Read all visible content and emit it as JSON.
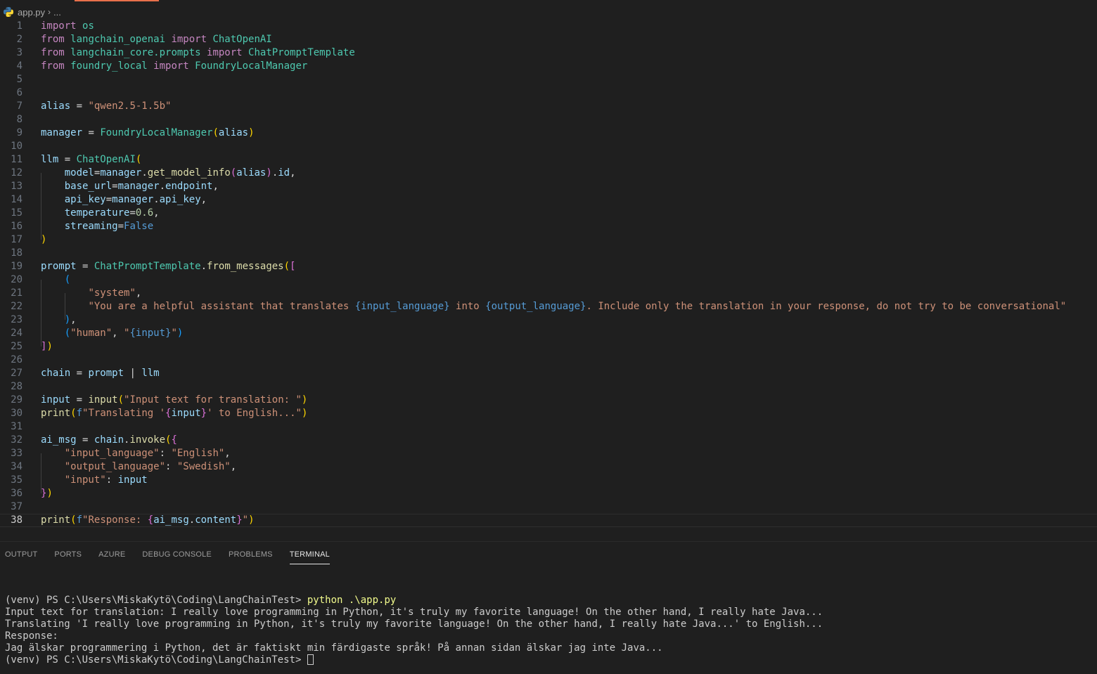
{
  "breadcrumb": {
    "file": "app.py",
    "rest": "..."
  },
  "colors": {
    "accent": "#e8704b",
    "background": "#1f1f1f",
    "keyword": "#c586c0",
    "string": "#ce9178",
    "class": "#4ec9b0",
    "variable": "#9cdcfe",
    "function": "#dcdcaa"
  },
  "editor": {
    "current_line": 38,
    "lines": [
      [
        {
          "t": "import ",
          "c": "kw"
        },
        {
          "t": "os",
          "c": "mod"
        }
      ],
      [
        {
          "t": "from ",
          "c": "kw"
        },
        {
          "t": "langchain_openai",
          "c": "mod"
        },
        {
          "t": " import ",
          "c": "kw"
        },
        {
          "t": "ChatOpenAI",
          "c": "cls"
        }
      ],
      [
        {
          "t": "from ",
          "c": "kw"
        },
        {
          "t": "langchain_core.prompts",
          "c": "mod"
        },
        {
          "t": " import ",
          "c": "kw"
        },
        {
          "t": "ChatPromptTemplate",
          "c": "cls"
        }
      ],
      [
        {
          "t": "from ",
          "c": "kw"
        },
        {
          "t": "foundry_local",
          "c": "mod"
        },
        {
          "t": " import ",
          "c": "kw"
        },
        {
          "t": "FoundryLocalManager",
          "c": "cls"
        }
      ],
      [],
      [],
      [
        {
          "t": "alias",
          "c": "var"
        },
        {
          "t": " = ",
          "c": "op"
        },
        {
          "t": "\"qwen2.5-1.5b\"",
          "c": "str"
        }
      ],
      [],
      [
        {
          "t": "manager",
          "c": "var"
        },
        {
          "t": " = ",
          "c": "op"
        },
        {
          "t": "FoundryLocalManager",
          "c": "cls"
        },
        {
          "t": "(",
          "c": "p1"
        },
        {
          "t": "alias",
          "c": "var"
        },
        {
          "t": ")",
          "c": "p1"
        }
      ],
      [],
      [
        {
          "t": "llm",
          "c": "var"
        },
        {
          "t": " = ",
          "c": "op"
        },
        {
          "t": "ChatOpenAI",
          "c": "cls"
        },
        {
          "t": "(",
          "c": "p1"
        }
      ],
      [
        {
          "t": "    "
        },
        {
          "t": "model",
          "c": "var"
        },
        {
          "t": "=",
          "c": "op"
        },
        {
          "t": "manager",
          "c": "var"
        },
        {
          "t": ".",
          "c": "op"
        },
        {
          "t": "get_model_info",
          "c": "fn"
        },
        {
          "t": "(",
          "c": "p2"
        },
        {
          "t": "alias",
          "c": "var"
        },
        {
          "t": ")",
          "c": "p2"
        },
        {
          "t": ".",
          "c": "op"
        },
        {
          "t": "id",
          "c": "var"
        },
        {
          "t": ",",
          "c": "op"
        }
      ],
      [
        {
          "t": "    "
        },
        {
          "t": "base_url",
          "c": "var"
        },
        {
          "t": "=",
          "c": "op"
        },
        {
          "t": "manager",
          "c": "var"
        },
        {
          "t": ".",
          "c": "op"
        },
        {
          "t": "endpoint",
          "c": "var"
        },
        {
          "t": ",",
          "c": "op"
        }
      ],
      [
        {
          "t": "    "
        },
        {
          "t": "api_key",
          "c": "var"
        },
        {
          "t": "=",
          "c": "op"
        },
        {
          "t": "manager",
          "c": "var"
        },
        {
          "t": ".",
          "c": "op"
        },
        {
          "t": "api_key",
          "c": "var"
        },
        {
          "t": ",",
          "c": "op"
        }
      ],
      [
        {
          "t": "    "
        },
        {
          "t": "temperature",
          "c": "var"
        },
        {
          "t": "=",
          "c": "op"
        },
        {
          "t": "0.6",
          "c": "num"
        },
        {
          "t": ",",
          "c": "op"
        }
      ],
      [
        {
          "t": "    "
        },
        {
          "t": "streaming",
          "c": "var"
        },
        {
          "t": "=",
          "c": "op"
        },
        {
          "t": "False",
          "c": "bool"
        }
      ],
      [
        {
          "t": ")",
          "c": "p1"
        }
      ],
      [],
      [
        {
          "t": "prompt",
          "c": "var"
        },
        {
          "t": " = ",
          "c": "op"
        },
        {
          "t": "ChatPromptTemplate",
          "c": "cls"
        },
        {
          "t": ".",
          "c": "op"
        },
        {
          "t": "from_messages",
          "c": "fn"
        },
        {
          "t": "(",
          "c": "p1"
        },
        {
          "t": "[",
          "c": "p2"
        }
      ],
      [
        {
          "t": "    "
        },
        {
          "t": "(",
          "c": "p3"
        }
      ],
      [
        {
          "t": "        "
        },
        {
          "t": "\"system\"",
          "c": "str"
        },
        {
          "t": ",",
          "c": "op"
        }
      ],
      [
        {
          "t": "        "
        },
        {
          "t": "\"You are a helpful assistant that translates ",
          "c": "str"
        },
        {
          "t": "{input_language}",
          "c": "interp"
        },
        {
          "t": " into ",
          "c": "str"
        },
        {
          "t": "{output_language}",
          "c": "interp"
        },
        {
          "t": ". Include only the translation in your response, do not try to be conversational\"",
          "c": "str"
        }
      ],
      [
        {
          "t": "    "
        },
        {
          "t": ")",
          "c": "p3"
        },
        {
          "t": ",",
          "c": "op"
        }
      ],
      [
        {
          "t": "    "
        },
        {
          "t": "(",
          "c": "p3"
        },
        {
          "t": "\"human\"",
          "c": "str"
        },
        {
          "t": ", ",
          "c": "op"
        },
        {
          "t": "\"",
          "c": "str"
        },
        {
          "t": "{input}",
          "c": "interp"
        },
        {
          "t": "\"",
          "c": "str"
        },
        {
          "t": ")",
          "c": "p3"
        }
      ],
      [
        {
          "t": "]",
          "c": "p2"
        },
        {
          "t": ")",
          "c": "p1"
        }
      ],
      [],
      [
        {
          "t": "chain",
          "c": "var"
        },
        {
          "t": " = ",
          "c": "op"
        },
        {
          "t": "prompt",
          "c": "var"
        },
        {
          "t": " | ",
          "c": "op"
        },
        {
          "t": "llm",
          "c": "var"
        }
      ],
      [],
      [
        {
          "t": "input",
          "c": "var"
        },
        {
          "t": " = ",
          "c": "op"
        },
        {
          "t": "input",
          "c": "fn"
        },
        {
          "t": "(",
          "c": "p1"
        },
        {
          "t": "\"Input text for translation: \"",
          "c": "str"
        },
        {
          "t": ")",
          "c": "p1"
        }
      ],
      [
        {
          "t": "print",
          "c": "fn"
        },
        {
          "t": "(",
          "c": "p1"
        },
        {
          "t": "f",
          "c": "fmt"
        },
        {
          "t": "\"Translating '",
          "c": "str"
        },
        {
          "t": "{",
          "c": "p2"
        },
        {
          "t": "input",
          "c": "var"
        },
        {
          "t": "}",
          "c": "p2"
        },
        {
          "t": "' to English...\"",
          "c": "str"
        },
        {
          "t": ")",
          "c": "p1"
        }
      ],
      [],
      [
        {
          "t": "ai_msg",
          "c": "var"
        },
        {
          "t": " = ",
          "c": "op"
        },
        {
          "t": "chain",
          "c": "var"
        },
        {
          "t": ".",
          "c": "op"
        },
        {
          "t": "invoke",
          "c": "fn"
        },
        {
          "t": "(",
          "c": "p1"
        },
        {
          "t": "{",
          "c": "p2"
        }
      ],
      [
        {
          "t": "    "
        },
        {
          "t": "\"input_language\"",
          "c": "str"
        },
        {
          "t": ": ",
          "c": "op"
        },
        {
          "t": "\"English\"",
          "c": "str"
        },
        {
          "t": ",",
          "c": "op"
        }
      ],
      [
        {
          "t": "    "
        },
        {
          "t": "\"output_language\"",
          "c": "str"
        },
        {
          "t": ": ",
          "c": "op"
        },
        {
          "t": "\"Swedish\"",
          "c": "str"
        },
        {
          "t": ",",
          "c": "op"
        }
      ],
      [
        {
          "t": "    "
        },
        {
          "t": "\"input\"",
          "c": "str"
        },
        {
          "t": ": ",
          "c": "op"
        },
        {
          "t": "input",
          "c": "var"
        }
      ],
      [
        {
          "t": "}",
          "c": "p2"
        },
        {
          "t": ")",
          "c": "p1"
        }
      ],
      [],
      [
        {
          "t": "print",
          "c": "fn"
        },
        {
          "t": "(",
          "c": "p1"
        },
        {
          "t": "f",
          "c": "fmt"
        },
        {
          "t": "\"Response: ",
          "c": "str"
        },
        {
          "t": "{",
          "c": "p2"
        },
        {
          "t": "ai_msg",
          "c": "var"
        },
        {
          "t": ".",
          "c": "op"
        },
        {
          "t": "content",
          "c": "var"
        },
        {
          "t": "}",
          "c": "p2"
        },
        {
          "t": "\"",
          "c": "str"
        },
        {
          "t": ")",
          "c": "p1"
        }
      ]
    ]
  },
  "panel": {
    "tabs": [
      "OUTPUT",
      "PORTS",
      "AZURE",
      "DEBUG CONSOLE",
      "PROBLEMS",
      "TERMINAL"
    ],
    "active_tab": "TERMINAL"
  },
  "terminal": {
    "prompt": "(venv) PS C:\\Users\\MiskaKytö\\Coding\\LangChainTest> ",
    "command": "python .\\app.py",
    "output": [
      "Input text for translation: I really love programming in Python, it's truly my favorite language! On the other hand, I really hate Java...",
      "Translating 'I really love programming in Python, it's truly my favorite language! On the other hand, I really hate Java...' to English...",
      "Response:",
      "Jag älskar programmering i Python, det är faktiskt min färdigaste språk! På annan sidan älskar jag inte Java..."
    ],
    "final_prompt": "(venv) PS C:\\Users\\MiskaKytö\\Coding\\LangChainTest> "
  }
}
